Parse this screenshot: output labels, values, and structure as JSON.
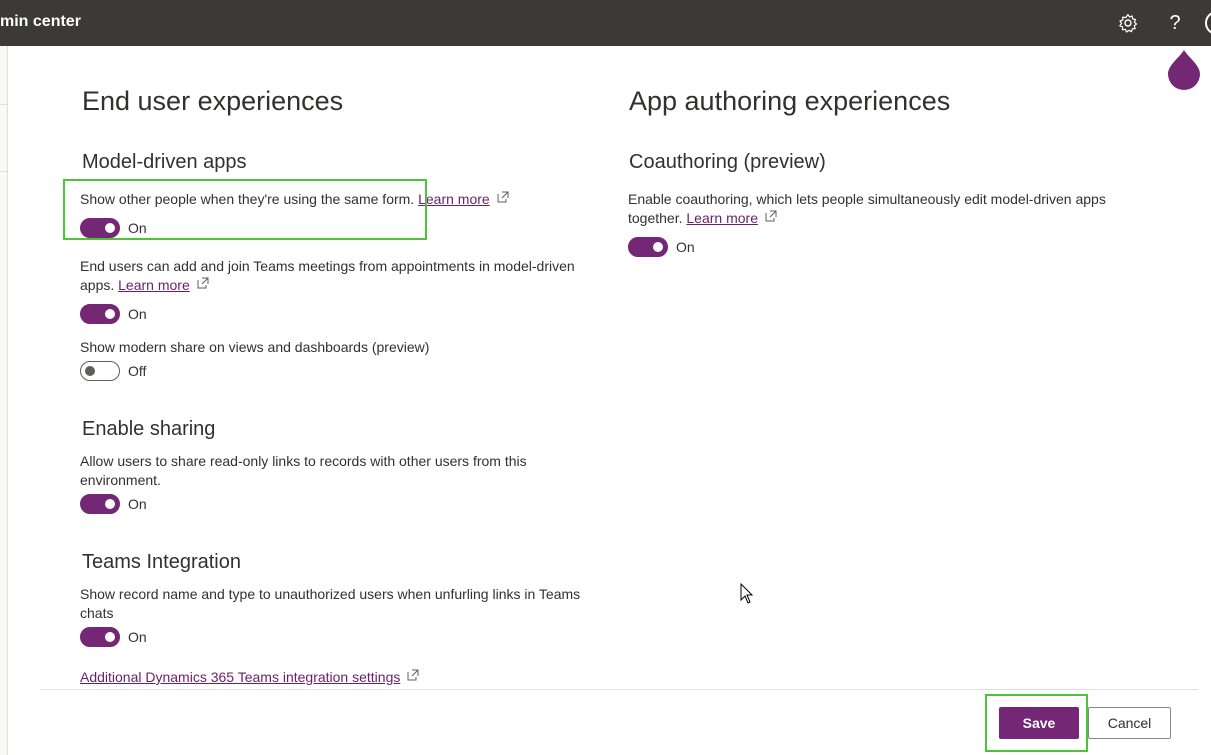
{
  "header": {
    "title": "min center",
    "settings_icon": "gear-icon",
    "help_label": "?"
  },
  "end_user": {
    "title": "End user experiences",
    "model_driven": {
      "title": "Model-driven apps",
      "collab": {
        "text": "Show other people when they're using the same form.",
        "link": "Learn more",
        "state": "On",
        "on": true
      },
      "teams_meetings": {
        "text": "End users can add and join Teams meetings from appointments in model-driven apps.",
        "link": "Learn more",
        "state": "On",
        "on": true
      },
      "modern_share": {
        "text": "Show modern share on views and dashboards (preview)",
        "state": "Off",
        "on": false
      }
    },
    "sharing": {
      "title": "Enable sharing",
      "text": "Allow users to share read-only links to records with other users from this environment.",
      "state": "On",
      "on": true
    },
    "teams": {
      "title": "Teams Integration",
      "text": "Show record name and type to unauthorized users when unfurling links in Teams chats",
      "state": "On",
      "on": true,
      "settings_link": "Additional Dynamics 365 Teams integration settings"
    }
  },
  "authoring": {
    "title": "App authoring experiences",
    "coauthoring": {
      "title": "Coauthoring (preview)",
      "text": "Enable coauthoring, which lets people simultaneously edit model-driven apps together.",
      "link": "Learn more",
      "state": "On",
      "on": true
    }
  },
  "footer": {
    "save_label": "Save",
    "cancel_label": "Cancel"
  },
  "colors": {
    "accent": "#742774",
    "topbar": "#3b3a39",
    "highlight": "#4cc43a"
  }
}
